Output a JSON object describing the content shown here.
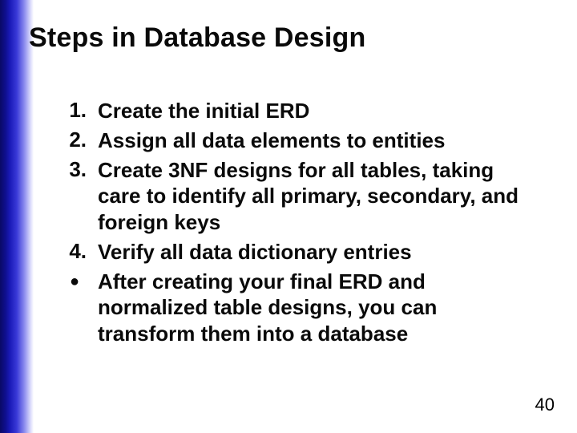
{
  "title": "Steps in Database Design",
  "items": [
    {
      "marker": "1.",
      "text": "Create the initial ERD"
    },
    {
      "marker": "2.",
      "text": "Assign all data elements to entities"
    },
    {
      "marker": "3.",
      "text": "Create 3NF designs for all tables, taking care to identify all primary, secondary, and foreign keys"
    },
    {
      "marker": "4.",
      "text": "Verify all data dictionary entries"
    },
    {
      "marker": "●",
      "text": "After creating your final ERD and normalized table designs, you can transform them into a database"
    }
  ],
  "page_number": "40"
}
